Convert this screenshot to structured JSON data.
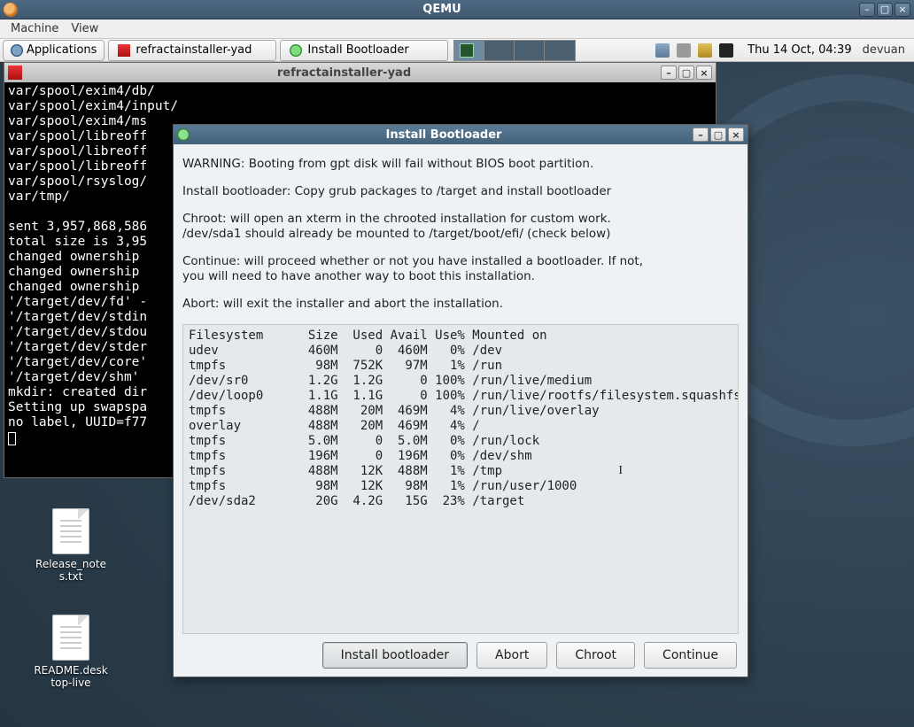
{
  "qemu": {
    "title": "QEMU",
    "menus": [
      "Machine",
      "View"
    ]
  },
  "panel": {
    "applications": "Applications",
    "tasks": [
      {
        "label": "refractainstaller-yad",
        "kind": "app"
      },
      {
        "label": "Install Bootloader",
        "kind": "inst"
      }
    ],
    "clock": "Thu 14 Oct, 04:39",
    "distro": "devuan"
  },
  "terminal": {
    "title": "refractainstaller-yad",
    "lines": [
      "var/spool/exim4/db/",
      "var/spool/exim4/input/",
      "var/spool/exim4/ms",
      "var/spool/libreoff",
      "var/spool/libreoff",
      "var/spool/libreoff",
      "var/spool/rsyslog/",
      "var/tmp/",
      "",
      "sent 3,957,868,586",
      "total size is 3,95",
      "changed ownership ",
      "changed ownership ",
      "changed ownership ",
      "'/target/dev/fd' -",
      "'/target/dev/stdin",
      "'/target/dev/stdou",
      "'/target/dev/stder",
      "'/target/dev/core'",
      "'/target/dev/shm' ",
      "mkdir: created dir",
      "Setting up swapspa",
      "no label, UUID=f77"
    ]
  },
  "dialog": {
    "title": "Install Bootloader",
    "paragraphs": [
      "WARNING: Booting from gpt disk will fail without BIOS boot partition.",
      "Install bootloader: Copy grub packages to /target and install bootloader",
      "Chroot: will open an xterm in the chrooted installation for custom work.\n/dev/sda1 should already be mounted to /target/boot/efi/ (check below)",
      "Continue: will proceed whether or not you have installed a bootloader. If not,\nyou will need to have another way to boot this installation.",
      "Abort: will exit the installer and abort the installation."
    ],
    "fs_header": "Filesystem      Size  Used Avail Use% Mounted on",
    "fs_rows": [
      {
        "fs": "udev",
        "size": "460M",
        "used": "0",
        "avail": "460M",
        "usep": "0%",
        "mount": "/dev"
      },
      {
        "fs": "tmpfs",
        "size": "98M",
        "used": "752K",
        "avail": "97M",
        "usep": "1%",
        "mount": "/run"
      },
      {
        "fs": "/dev/sr0",
        "size": "1.2G",
        "used": "1.2G",
        "avail": "0",
        "usep": "100%",
        "mount": "/run/live/medium"
      },
      {
        "fs": "/dev/loop0",
        "size": "1.1G",
        "used": "1.1G",
        "avail": "0",
        "usep": "100%",
        "mount": "/run/live/rootfs/filesystem.squashfs"
      },
      {
        "fs": "tmpfs",
        "size": "488M",
        "used": "20M",
        "avail": "469M",
        "usep": "4%",
        "mount": "/run/live/overlay"
      },
      {
        "fs": "overlay",
        "size": "488M",
        "used": "20M",
        "avail": "469M",
        "usep": "4%",
        "mount": "/"
      },
      {
        "fs": "tmpfs",
        "size": "5.0M",
        "used": "0",
        "avail": "5.0M",
        "usep": "0%",
        "mount": "/run/lock"
      },
      {
        "fs": "tmpfs",
        "size": "196M",
        "used": "0",
        "avail": "196M",
        "usep": "0%",
        "mount": "/dev/shm"
      },
      {
        "fs": "tmpfs",
        "size": "488M",
        "used": "12K",
        "avail": "488M",
        "usep": "1%",
        "mount": "/tmp"
      },
      {
        "fs": "tmpfs",
        "size": "98M",
        "used": "12K",
        "avail": "98M",
        "usep": "1%",
        "mount": "/run/user/1000"
      },
      {
        "fs": "/dev/sda2",
        "size": "20G",
        "used": "4.2G",
        "avail": "15G",
        "usep": "23%",
        "mount": "/target"
      }
    ],
    "buttons": {
      "install": "Install bootloader",
      "abort": "Abort",
      "chroot": "Chroot",
      "continue": "Continue"
    }
  },
  "desktop_icons": [
    {
      "label": "Release_note\ns.txt"
    },
    {
      "label": "README.desk\ntop-live"
    }
  ]
}
